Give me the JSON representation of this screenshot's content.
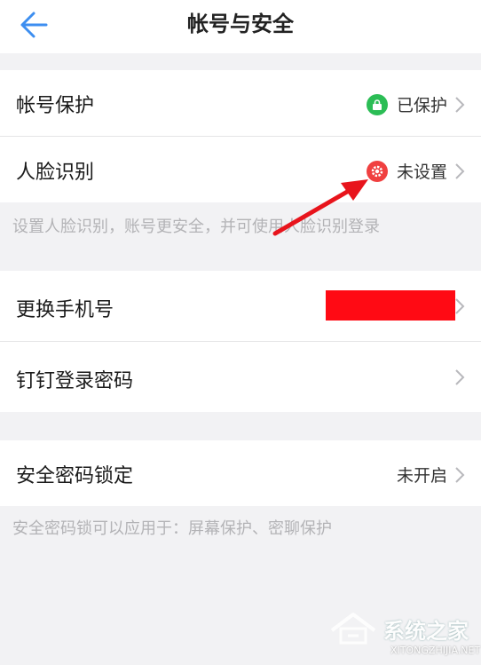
{
  "header": {
    "title": "帐号与安全",
    "back_icon": "arrow-left-icon",
    "accent": "#3d8ef0"
  },
  "rows": {
    "account_protect": {
      "label": "帐号保护",
      "value": "已保护",
      "icon": "lock-icon",
      "icon_color": "#2bbd55"
    },
    "face_recognition": {
      "label": "人脸识别",
      "value": "未设置",
      "icon": "gear-icon",
      "icon_color": "#f04040"
    },
    "change_phone": {
      "label": "更换手机号",
      "value": ""
    },
    "login_password": {
      "label": "钉钉登录密码"
    },
    "security_lock": {
      "label": "安全密码锁定",
      "value": "未开启"
    }
  },
  "hints": {
    "face": "设置人脸识别，账号更安全，并可使用人脸识别登录",
    "lock": "安全密码锁可以应用于：屏幕保护、密聊保护"
  },
  "watermark": {
    "text": "系统之家",
    "url": "XITONGZHIJIA.NET"
  }
}
